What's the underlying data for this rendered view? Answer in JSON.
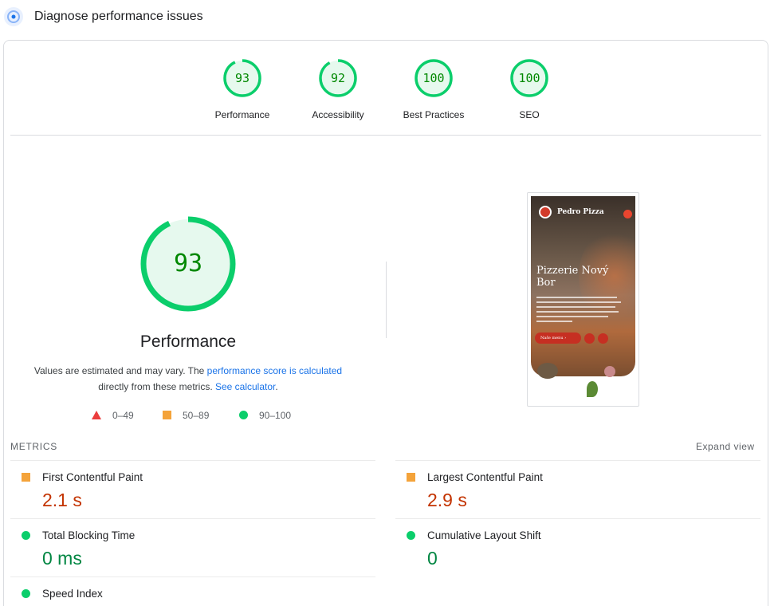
{
  "header": {
    "title": "Diagnose performance issues",
    "icon": "pagespeed-gauge-icon"
  },
  "colors": {
    "pass": "#0bce6b",
    "pass_text": "#008800",
    "average": "#f4a33a",
    "fail": "#eb3d3d",
    "link": "#1a73e8"
  },
  "categories": [
    {
      "label": "Performance",
      "score": "93",
      "fraction": 0.93
    },
    {
      "label": "Accessibility",
      "score": "92",
      "fraction": 0.92
    },
    {
      "label": "Best Practices",
      "score": "100",
      "fraction": 1.0
    },
    {
      "label": "SEO",
      "score": "100",
      "fraction": 1.0
    }
  ],
  "main_score": {
    "score": "93",
    "fraction": 0.93,
    "label": "Performance",
    "note_prefix": "Values are estimated and may vary. The ",
    "note_link1": "performance score is calculated",
    "note_middle": " directly from these metrics. ",
    "note_link2": "See calculator",
    "note_suffix": "."
  },
  "legend": [
    {
      "range": "0–49",
      "shape": "triangle"
    },
    {
      "range": "50–89",
      "shape": "square"
    },
    {
      "range": "90–100",
      "shape": "circle"
    }
  ],
  "screenshot": {
    "brand": "Pedro Pizza",
    "heading": "Pizzerie Nový Bor",
    "button": "Naše menu  ›"
  },
  "metrics": {
    "title": "METRICS",
    "expand": "Expand view",
    "items": [
      {
        "name": "First Contentful Paint",
        "value": "2.1 s",
        "rating": "average"
      },
      {
        "name": "Largest Contentful Paint",
        "value": "2.9 s",
        "rating": "average"
      },
      {
        "name": "Total Blocking Time",
        "value": "0 ms",
        "rating": "pass"
      },
      {
        "name": "Cumulative Layout Shift",
        "value": "0",
        "rating": "pass"
      },
      {
        "name": "Speed Index",
        "value": "",
        "rating": "pass"
      }
    ]
  }
}
